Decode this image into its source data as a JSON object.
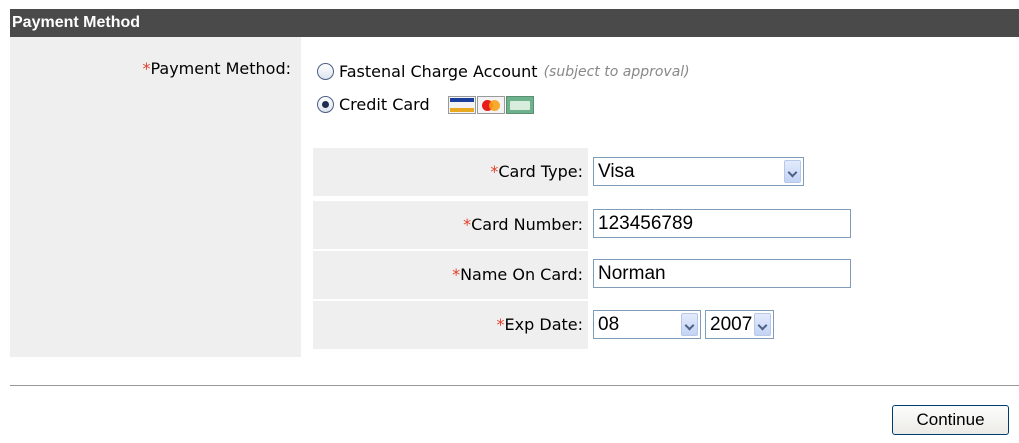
{
  "section": {
    "title": "Payment Method"
  },
  "payment_method": {
    "required_mark": "*",
    "label": "Payment Method:",
    "options": [
      {
        "label": "Fastenal Charge Account",
        "note": "(subject to approval)",
        "checked": false
      },
      {
        "label": "Credit Card",
        "checked": true,
        "icons": [
          "visa-card-icon",
          "mastercard-icon",
          "discover-card-icon"
        ]
      }
    ]
  },
  "card_form": {
    "card_type": {
      "required_mark": "*",
      "label": "Card Type:",
      "value": "Visa"
    },
    "card_number": {
      "required_mark": "*",
      "label": "Card Number:",
      "value": "123456789"
    },
    "name_on_card": {
      "required_mark": "*",
      "label": "Name On Card:",
      "value": "Norman"
    },
    "exp_date": {
      "required_mark": "*",
      "label": "Exp Date:",
      "month": "08",
      "year": "2007"
    }
  },
  "actions": {
    "continue_label": "Continue"
  },
  "colors": {
    "header_bg": "#4a4a4a",
    "panel_bg": "#efefef",
    "required": "#e0402b",
    "input_border": "#7f9db9"
  }
}
